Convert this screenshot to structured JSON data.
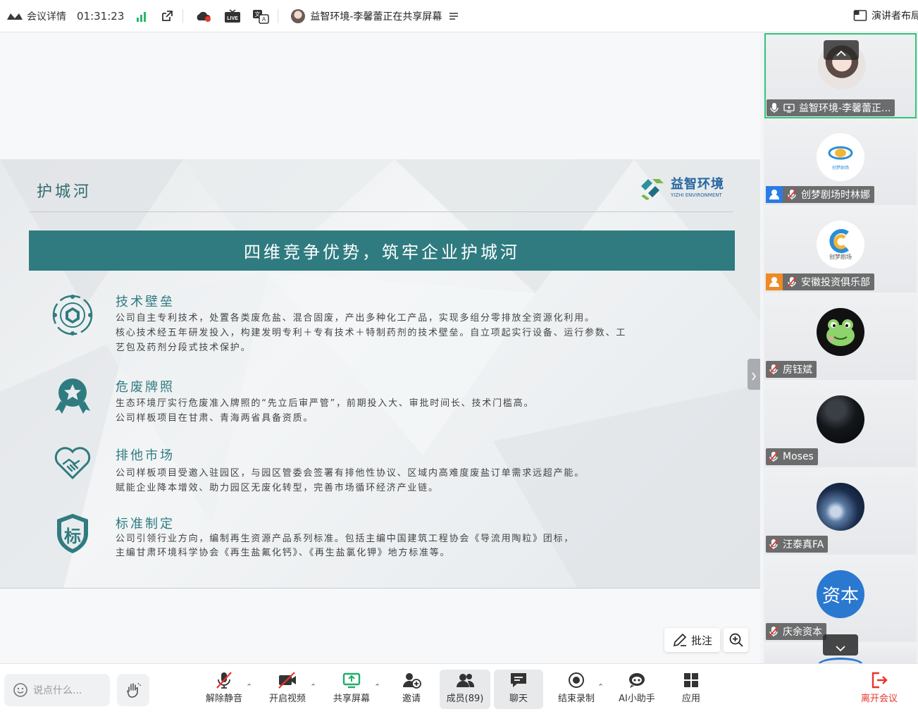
{
  "topbar": {
    "meeting_details": "会议详情",
    "timer": "01:31:23",
    "share_status": "益智环境-李馨蕾正在共享屏幕",
    "presenter_layout": "演讲者布局"
  },
  "slide": {
    "title": "护城河",
    "logo_name": "益智环境",
    "logo_sub": "YIZHI ENVIRONMENT",
    "banner": "四维竞争优势，筑牢企业护城河",
    "sections": [
      {
        "heading": "技术壁垒",
        "lines": [
          "公司自主专利技术，处置各类废危盐、混合固废，产出多种化工产品，实现多组分零排放全资源化利用。",
          "核心技术经五年研发投入，构建发明专利＋专有技术＋特制药剂的技术壁垒。自立项起实行设备、运行参数、工",
          "艺包及药剂分段式技术保护。"
        ]
      },
      {
        "heading": "危废牌照",
        "lines": [
          "生态环境厅实行危废准入牌照的“先立后审严管”，前期投入大、审批时间长、技术门槛高。",
          "公司样板项目在甘肃、青海两省具备资质。"
        ]
      },
      {
        "heading": "排他市场",
        "lines": [
          "公司样板项目受邀入驻园区，与园区管委会签署有排他性协议、区域内高难度废盐订单需求远超产能。",
          "赋能企业降本增效、助力园区无废化转型，完善市场循环经济产业链。"
        ]
      },
      {
        "heading": "标准制定",
        "lines": [
          "公司引领行业方向，编制再生资源产品系列标准。包括主编中国建筑工程协会《导流用陶粒》团标，",
          "主编甘肃环境科学协会《再生盐氟化钙》、《再生盐氯化钾》地方标准等。"
        ]
      }
    ],
    "standard_badge_char": "标"
  },
  "annotate": {
    "label": "批注"
  },
  "participants": [
    {
      "name": "益智环境-李馨蕾正...",
      "avatar_text": ""
    },
    {
      "name": "创梦剧场时林娜",
      "avatar_text": "创梦剧场"
    },
    {
      "name": "安徽投资俱乐部",
      "avatar_text": "创梦剧场"
    },
    {
      "name": "房钰斌",
      "avatar_text": ""
    },
    {
      "name": "Moses",
      "avatar_text": ""
    },
    {
      "name": "汪泰真FA",
      "avatar_text": ""
    },
    {
      "name": "庆余资本",
      "avatar_text": "资本"
    }
  ],
  "chat_input": {
    "placeholder": "说点什么..."
  },
  "toolbar": {
    "unmute": "解除静音",
    "start_video": "开启视频",
    "share_screen": "共享屏幕",
    "invite": "邀请",
    "members": "成员(89)",
    "chat": "聊天",
    "end_recording": "结束录制",
    "ai_assistant": "AI小助手",
    "apps": "应用",
    "leave": "离开会议"
  },
  "colors": {
    "teal": "#2f7b80",
    "green_status": "#2db56a",
    "leave_red": "#e8372b",
    "share_green": "#1fae6a",
    "highlight_border": "#33c47b"
  }
}
